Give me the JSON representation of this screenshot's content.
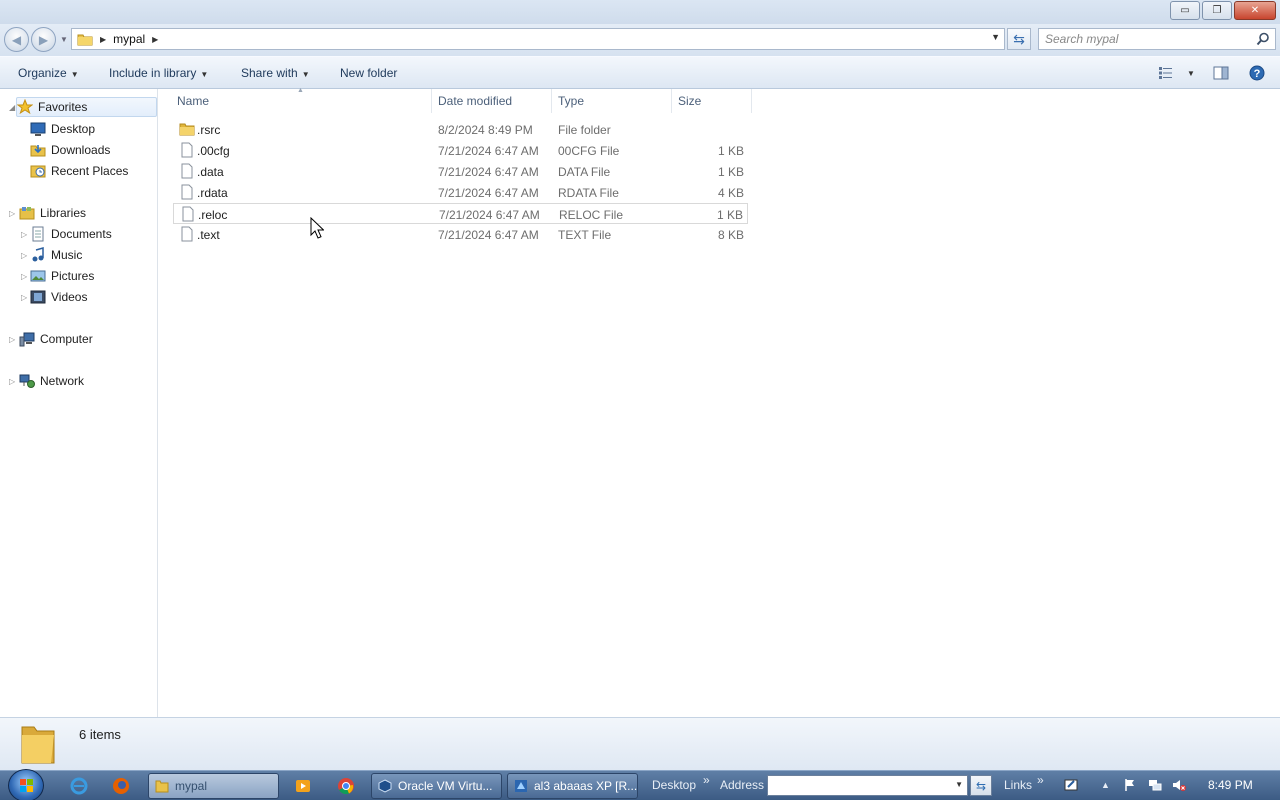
{
  "window": {
    "buttons": {
      "minimize": "▭",
      "maximize": "❐",
      "close": "✕"
    }
  },
  "address_bar": {
    "breadcrumb": [
      "mypal"
    ],
    "search_placeholder": "Search mypal"
  },
  "toolbar": {
    "organize": "Organize",
    "include_in_library": "Include in library",
    "share_with": "Share with",
    "new_folder": "New folder"
  },
  "nav": {
    "favorites": {
      "label": "Favorites",
      "items": [
        "Desktop",
        "Downloads",
        "Recent Places"
      ]
    },
    "libraries": {
      "label": "Libraries",
      "items": [
        "Documents",
        "Music",
        "Pictures",
        "Videos"
      ]
    },
    "computer": "Computer",
    "network": "Network"
  },
  "columns": {
    "name": "Name",
    "date_modified": "Date modified",
    "type": "Type",
    "size": "Size"
  },
  "files": [
    {
      "name": ".rsrc",
      "date": "8/2/2024 8:49 PM",
      "type": "File folder",
      "size": "",
      "icon": "folder-icon"
    },
    {
      "name": ".00cfg",
      "date": "7/21/2024 6:47 AM",
      "type": "00CFG File",
      "size": "1 KB",
      "icon": "file-icon"
    },
    {
      "name": ".data",
      "date": "7/21/2024 6:47 AM",
      "type": "DATA File",
      "size": "1 KB",
      "icon": "file-icon"
    },
    {
      "name": ".rdata",
      "date": "7/21/2024 6:47 AM",
      "type": "RDATA File",
      "size": "4 KB",
      "icon": "file-icon"
    },
    {
      "name": ".reloc",
      "date": "7/21/2024 6:47 AM",
      "type": "RELOC File",
      "size": "1 KB",
      "icon": "file-icon"
    },
    {
      "name": ".text",
      "date": "7/21/2024 6:47 AM",
      "type": "TEXT File",
      "size": "8 KB",
      "icon": "file-icon"
    }
  ],
  "status": {
    "item_count": "6 items"
  },
  "taskbar": {
    "buttons": [
      "mypal",
      "Oracle VM Virtu...",
      "al3 abaaas XP [R..."
    ],
    "desktop": "Desktop",
    "chevron": "»",
    "address_label": "Address",
    "links": "Links",
    "clock": "8:49 PM"
  },
  "colors": {
    "accent": "#1e395b",
    "taskbar": "#4a6a94",
    "selection": "#e3eefb"
  }
}
